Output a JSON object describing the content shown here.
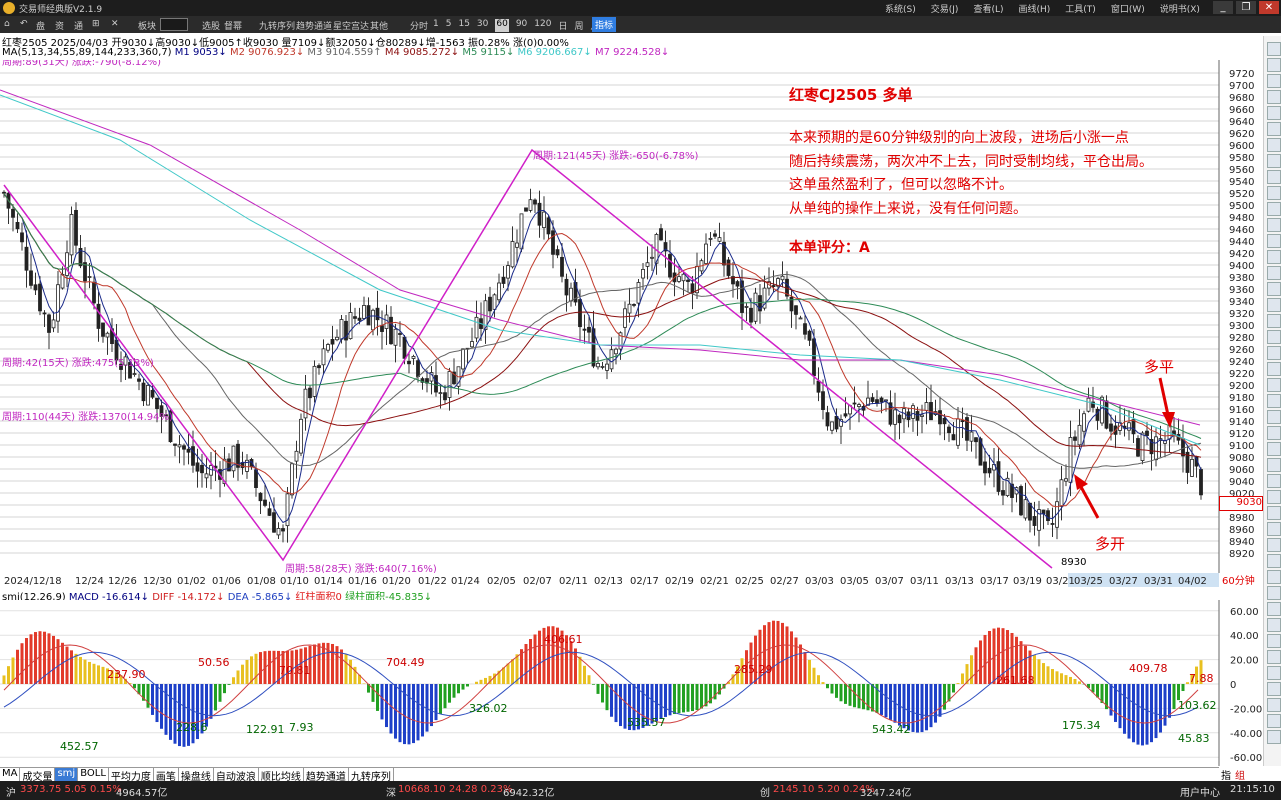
{
  "window": {
    "app_name": "交易师经典版V2.1.9",
    "menus": [
      "系统(S)",
      "交易(J)",
      "查看(L)",
      "画线(H)",
      "工具(T)",
      "窗口(W)",
      "说明书(X)"
    ]
  },
  "toolbar": {
    "items": [
      "盘",
      "资",
      "通",
      "⊞",
      "✕"
    ],
    "mode_label": "板块",
    "mode_value": "",
    "links": [
      "选股",
      "督幂",
      "九转序列",
      "趋势通道",
      "星空宫达",
      "其他"
    ],
    "period_label": "分时",
    "periods": [
      "1",
      "5",
      "15",
      "30",
      "60",
      "90",
      "120",
      "日",
      "周",
      "月"
    ],
    "period_selected": "60",
    "indicator_button": "指标"
  },
  "quote": {
    "line": "红枣2505 2025/04/03 开9030↓高9030↓低9005↑收9030 量7109↓额32050↓仓80289↓增-1563 振0.28% 涨(0)0.00%",
    "ma_params": "MA(5,13,34,55,89,144,233,360,7)",
    "ma_values": [
      {
        "label": "M1 9053↓",
        "color": "#000080"
      },
      {
        "label": "M2 9076.923↓",
        "color": "#c0392b"
      },
      {
        "label": "M3 9104.559↑",
        "color": "#666666"
      },
      {
        "label": "M4 9085.272↓",
        "color": "#8b1010"
      },
      {
        "label": "M5 9115↓",
        "color": "#2e8b57"
      },
      {
        "label": "M6 9206.667↓",
        "color": "#40c8c8"
      },
      {
        "label": "M7 9224.528↓",
        "color": "#c028c0"
      }
    ]
  },
  "wave_labels": [
    {
      "text": "周期:89(31天) 涨跌:-790(-8.12%)"
    },
    {
      "text": "周期:121(45天) 涨跌:-650(-6.78%)"
    },
    {
      "text": "周期:42(15天) 涨跌:475(5.13%)"
    },
    {
      "text": "周期:110(44天) 涨跌:1370(14.94%)"
    },
    {
      "text": "周期:58(28天) 涨跌:640(7.16%)"
    }
  ],
  "annotation": {
    "title": "红枣CJ2505 多单",
    "lines": [
      "本来预期的是60分钟级别的向上波段，进场后小涨一点",
      "随后持续震荡，两次冲不上去，同时受制均线，平仓出局。",
      "这单虽然盈利了，但可以忽略不计。",
      "从单纯的操作上来说，没有任何问题。"
    ],
    "score": "本单评分：A",
    "open_label": "多开",
    "close_label": "多平",
    "low_label": "8930",
    "last_price": "9030",
    "accent": "#e00000"
  },
  "price_axis": [
    "9720",
    "9700",
    "9680",
    "9660",
    "9640",
    "9620",
    "9600",
    "9580",
    "9560",
    "9540",
    "9520",
    "9500",
    "9480",
    "9460",
    "9440",
    "9420",
    "9400",
    "9380",
    "9360",
    "9340",
    "9320",
    "9300",
    "9280",
    "9260",
    "9240",
    "9220",
    "9200",
    "9180",
    "9160",
    "9140",
    "9120",
    "9100",
    "9080",
    "9060",
    "9040",
    "9020",
    "9000",
    "8980",
    "8960",
    "8940",
    "8920"
  ],
  "date_axis": {
    "labels": [
      "2024/12/18",
      "12/24",
      "12/26",
      "12/30",
      "01/02",
      "01/06",
      "01/08",
      "01/10",
      "01/14",
      "01/16",
      "01/20",
      "01/22",
      "01/24",
      "02/05",
      "02/07",
      "02/11",
      "02/13",
      "02/17",
      "02/19",
      "02/21",
      "02/25",
      "02/27",
      "03/03",
      "03/05",
      "03/07",
      "03/11",
      "03/13",
      "03/17",
      "03/19",
      "03/21",
      "03/25",
      "03/27",
      "03/31",
      "04/02"
    ],
    "period_tag": "60分钟"
  },
  "macd": {
    "header_name": "smj(12,26,9)",
    "values": [
      {
        "label": "MACD -16.614↓",
        "color": "#000080"
      },
      {
        "label": "DIFF -14.172↓",
        "color": "#d02020"
      },
      {
        "label": "DEA -5.865↓",
        "color": "#2040c0"
      },
      {
        "label": "红柱面积0",
        "color": "#e02020"
      },
      {
        "label": "绿柱面积-45.835↓",
        "color": "#20a020"
      }
    ],
    "axis": [
      "60.00",
      "40.00",
      "20.00",
      "0",
      "-20.00",
      "-40.00",
      "-60.00"
    ],
    "area_labels": [
      "237.90",
      "50.56",
      "70.81",
      "704.49",
      "406.61",
      "285.29",
      "261.68",
      "409.78",
      "7.88",
      "452.57",
      "228.6",
      "122.91",
      "7.93",
      "326.02",
      "535.57",
      "543.42",
      "175.34",
      "103.62",
      "45.83"
    ]
  },
  "tabs": {
    "items": [
      "MA",
      "成交量",
      "smj",
      "BOLL",
      "平均力度",
      "画笔",
      "操盘线",
      "自动波浪",
      "顺比均线",
      "趋势通道",
      "九转序列"
    ],
    "active": "smj",
    "right": [
      "指",
      "组"
    ]
  },
  "status": {
    "sh": {
      "name": "沪",
      "value": "3373.75 5.05 0.15%",
      "amount": "4964.57亿"
    },
    "sz": {
      "name": "深",
      "value": "10668.10 24.28 0.23%",
      "amount": "6942.32亿"
    },
    "cy": {
      "name": "创",
      "value": "2145.10 5.20 0.24%",
      "amount": "3247.24亿"
    },
    "user": "用户中心",
    "time": "21:15:10"
  }
}
